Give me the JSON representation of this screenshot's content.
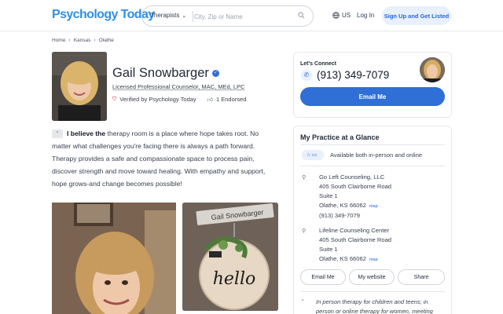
{
  "header": {
    "logo": "Psychology Today",
    "search_category": "Therapists",
    "search_placeholder": "City, Zip or Name",
    "language": "US",
    "login_label": "Log In",
    "signup_label": "Sign Up and Get Listed"
  },
  "breadcrumb": [
    "Home",
    "Kansas",
    "Olathe"
  ],
  "profile": {
    "name": "Gail Snowbarger",
    "credentials": "Licensed Professional Counselor, MAC, MEd, LPC",
    "verified_text": "Verified by Psychology Today",
    "endorsed_text": "1 Endorsed",
    "bio_lead": "I believe the",
    "bio_rest": " therapy room is a place where hope takes root. No matter what challenges you're facing there is always a path forward. Therapy provides a safe and compassionate space to process pain, discover strength and move toward healing. With empathy and support, hope grows-and change becomes possible!",
    "sign_text": "Gail Snowbarger",
    "hello_text": "hello"
  },
  "contact": {
    "title": "Let's Connect",
    "phone": "(913) 349-7079",
    "email_button": "Email Me"
  },
  "practice": {
    "title": "My Practice at a Glance",
    "availability": "Available both in-person and online",
    "locations": [
      {
        "name": "Go Left Counseling, LLC",
        "street": "405 South Clairborne Road",
        "suite": "Suite 1",
        "city": "Olathe, KS 66062",
        "map_label": "map",
        "phone": "(913) 349-7079"
      },
      {
        "name": "Lifeline Counseling Center",
        "street": "405 South Clairborne Road",
        "suite": "Suite 1",
        "city": "Olathe, KS 66062",
        "map_label": "map"
      }
    ],
    "buttons": {
      "email": "Email Me",
      "website": "My website",
      "share": "Share"
    },
    "note": "In person therapy for children and teens; in person or online therapy for women, meeting"
  },
  "colors": {
    "brand": "#2f8fe6",
    "primary_button": "#2f6fd6",
    "verified_badge": "#2f6fd6",
    "signup_bg": "#e8f0fb"
  }
}
